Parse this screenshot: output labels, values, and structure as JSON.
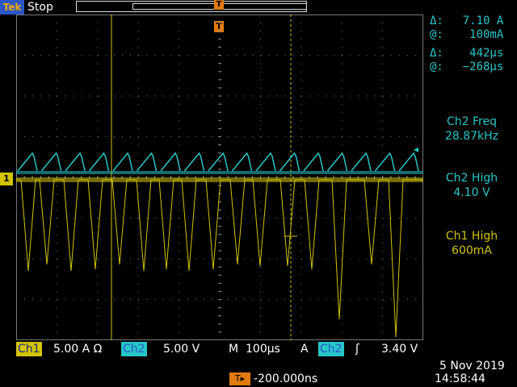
{
  "header": {
    "brand": "Tek",
    "run_status": "Stop",
    "trigger_position_glyph": "T"
  },
  "cursor_readouts": {
    "delta_amp_label": "Δ:",
    "delta_amp_value": "7.10 A",
    "at_amp_label": "@:",
    "at_amp_value": "100mA",
    "delta_time_label": "Δ:",
    "delta_time_value": "442µs",
    "at_time_label": "@:",
    "at_time_value": "−268µs"
  },
  "measurements": [
    {
      "label": "Ch2 Freq",
      "value": "28.87kHz"
    },
    {
      "label": "Ch2 High",
      "value": "4.10 V"
    },
    {
      "label": "Ch1 High",
      "value": "600mA"
    }
  ],
  "channel_markers": {
    "ch1": "1"
  },
  "bottom_bar": {
    "ch1_tag": "Ch1",
    "ch1_scale": "5.00 A Ω",
    "ch2_tag": "Ch2",
    "ch2_scale": "5.00 V",
    "timebase_label": "M",
    "timebase_value": "100µs",
    "trigger_mode": "A",
    "trigger_source": "Ch2",
    "trigger_slope": "ʃ",
    "trigger_level": "3.40 V"
  },
  "trigger_offset": "-200.000ns",
  "date": "5 Nov 2019",
  "time": "14:58:44",
  "colors": {
    "ch1": "#d2c400",
    "ch2": "#27c6c8",
    "trigger": "#e07a10",
    "brand_bg": "#2b56c8"
  }
}
